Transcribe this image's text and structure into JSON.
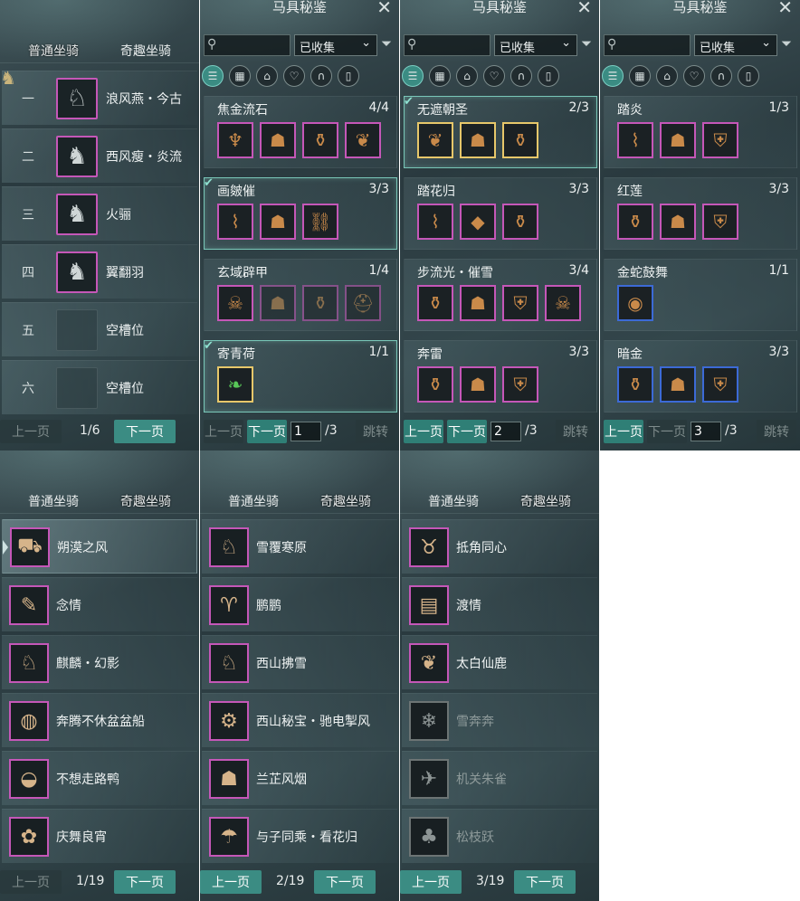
{
  "tabs": {
    "normal": "普通坐骑",
    "fun": "奇趣坐骑"
  },
  "top_left": {
    "slots": [
      {
        "num": "一",
        "name": "浪风燕・今古",
        "icon": "horse-white-icon",
        "empty": false
      },
      {
        "num": "二",
        "name": "西风瘦・炎流",
        "icon": "horse-black-icon",
        "empty": false
      },
      {
        "num": "三",
        "name": "火骊",
        "icon": "horse-red-icon",
        "empty": false
      },
      {
        "num": "四",
        "name": "翼翻羽",
        "icon": "horse-black-icon",
        "empty": false
      },
      {
        "num": "五",
        "name": "空槽位",
        "icon": "empty-slot-icon",
        "empty": true
      },
      {
        "num": "六",
        "name": "空槽位",
        "icon": "empty-slot-icon",
        "empty": true
      }
    ],
    "pager": {
      "prev": "上一页",
      "info": "1/6",
      "next": "下一页"
    }
  },
  "gear_title": "马具秘鉴",
  "gear_filter_label": "已收集",
  "gear_pages": [
    {
      "page_value": "1",
      "total": "/3",
      "prev": "上一页",
      "next": "下一页",
      "jump": "跳转",
      "sets": [
        {
          "name": "焦金流石",
          "count": "4/4",
          "done": false,
          "items": [
            "gold-helm",
            "gold-saddle",
            "gold-stirrup",
            "gold-wing"
          ],
          "border": "pink"
        },
        {
          "name": "画皴催",
          "count": "3/3",
          "done": true,
          "items": [
            "blue-reins",
            "blue-saddle",
            "blue-chain"
          ],
          "border": "pink"
        },
        {
          "name": "玄域辟甲",
          "count": "1/4",
          "done": false,
          "items": [
            "bone-mask",
            "dark-saddle",
            "dark-stirrup",
            "red-helm"
          ],
          "border": "pink"
        },
        {
          "name": "寄青荷",
          "count": "1/1",
          "done": true,
          "items": [
            "green-leaf"
          ],
          "border": "gold"
        }
      ]
    },
    {
      "page_value": "2",
      "total": "/3",
      "prev": "上一页",
      "next": "下一页",
      "jump": "跳转",
      "sets": [
        {
          "name": "无遮朝圣",
          "count": "2/3",
          "done": true,
          "items": [
            "gold-wing",
            "ivory-saddle",
            "silver-stirrup"
          ],
          "border": "gold"
        },
        {
          "name": "踏花归",
          "count": "3/3",
          "done": false,
          "items": [
            "red-reins",
            "red-saddle",
            "teal-stirrup"
          ],
          "border": "pink"
        },
        {
          "name": "步流光・催雪",
          "count": "3/4",
          "done": false,
          "items": [
            "gold-stirrup",
            "gold-saddle",
            "gold-armor",
            "ghost-mask"
          ],
          "border": "pink"
        },
        {
          "name": "奔雷",
          "count": "3/3",
          "done": false,
          "items": [
            "gold-stirrup",
            "gold-saddle",
            "gold-armor"
          ],
          "border": "pink"
        }
      ]
    },
    {
      "page_value": "3",
      "total": "/3",
      "prev": "上一页",
      "next": "下一页",
      "jump": "跳转",
      "sets": [
        {
          "name": "踏炎",
          "count": "1/3",
          "done": false,
          "items": [
            "dark-reins",
            "dark-saddle",
            "gold-armor"
          ],
          "border": "pink"
        },
        {
          "name": "红莲",
          "count": "3/3",
          "done": false,
          "items": [
            "gold-stirrup",
            "gold-saddle",
            "gold-armor"
          ],
          "border": "pink"
        },
        {
          "name": "金蛇鼓舞",
          "count": "1/1",
          "done": false,
          "items": [
            "drum"
          ],
          "border": "blue"
        },
        {
          "name": "暗金",
          "count": "3/3",
          "done": false,
          "items": [
            "gold-stirrup",
            "gold-saddle",
            "gold-armor"
          ],
          "border": "blue"
        }
      ]
    }
  ],
  "fun_pages": [
    {
      "pager": {
        "prev": "上一页",
        "info": "1/19",
        "next": "下一页"
      },
      "items": [
        {
          "name": "朔漠之风",
          "icon": "cart-icon",
          "dim": false,
          "selected": true
        },
        {
          "name": "念情",
          "icon": "scroll-icon",
          "dim": false,
          "selected": false
        },
        {
          "name": "麒麟・幻影",
          "icon": "kirin-icon",
          "dim": false,
          "selected": false
        },
        {
          "name": "奔腾不休盆盆船",
          "icon": "tub-icon",
          "dim": false,
          "selected": false
        },
        {
          "name": "不想走路鸭",
          "icon": "duck-icon",
          "dim": false,
          "selected": false
        },
        {
          "name": "庆舞良宵",
          "icon": "lion-dance-icon",
          "dim": false,
          "selected": false
        }
      ]
    },
    {
      "pager": {
        "prev": "上一页",
        "info": "2/19",
        "next": "下一页"
      },
      "items": [
        {
          "name": "雪覆寒原",
          "icon": "white-deer-icon",
          "dim": false,
          "selected": false
        },
        {
          "name": "鹏鹏",
          "icon": "sheep-icon",
          "dim": false,
          "selected": false
        },
        {
          "name": "西山拂雪",
          "icon": "white-deer-icon",
          "dim": false,
          "selected": false
        },
        {
          "name": "西山秘宝・驰电掣风",
          "icon": "mecha-icon",
          "dim": false,
          "selected": false
        },
        {
          "name": "兰芷风烟",
          "icon": "lamp-icon",
          "dim": false,
          "selected": false
        },
        {
          "name": "与子同乘・看花归",
          "icon": "umbrella-icon",
          "dim": false,
          "selected": false
        }
      ]
    },
    {
      "pager": {
        "prev": "上一页",
        "info": "3/19",
        "next": "下一页"
      },
      "items": [
        {
          "name": "抵角同心",
          "icon": "ox-cart-icon",
          "dim": false,
          "selected": false
        },
        {
          "name": "渡情",
          "icon": "raft-icon",
          "dim": false,
          "selected": false
        },
        {
          "name": "太白仙鹿",
          "icon": "antler-icon",
          "dim": false,
          "selected": false
        },
        {
          "name": "雪奔奔",
          "icon": "snow-beast-icon",
          "dim": true,
          "selected": false
        },
        {
          "name": "机关朱雀",
          "icon": "mech-bird-icon",
          "dim": true,
          "selected": false
        },
        {
          "name": "松枝跃",
          "icon": "pine-beast-icon",
          "dim": true,
          "selected": false
        }
      ]
    }
  ]
}
